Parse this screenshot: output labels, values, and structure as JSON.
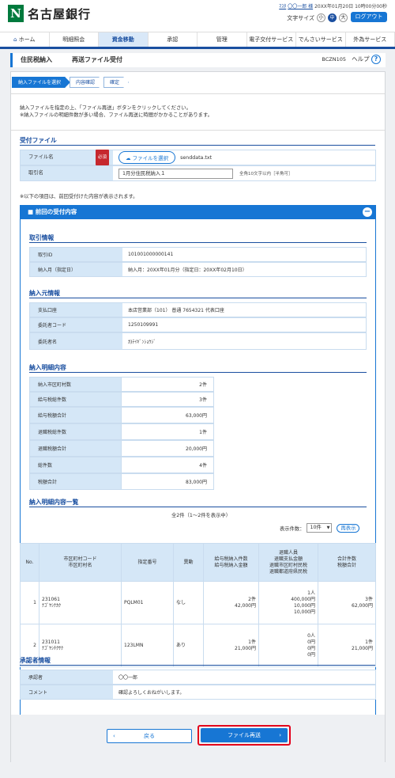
{
  "header": {
    "logo_mark": "N",
    "bank_name": "名古屋銀行",
    "user_prefix": "ﾏｽﾀ",
    "user_name": "〇〇一郎 様",
    "login_time": "20XX年01月20日 10時00分00秒",
    "font_size_label": "文字サイズ",
    "font_small": "小",
    "font_medium": "中",
    "font_large": "大",
    "logout": "ログアウト"
  },
  "nav": {
    "items": [
      "ホーム",
      "明細照会",
      "資金移動",
      "承認",
      "管理",
      "電子交付サービス",
      "でんさいサービス",
      "外為サービス"
    ]
  },
  "page": {
    "title_a": "住民税納入",
    "title_b": "再送ファイル受付",
    "code": "BCZN105",
    "help": "ヘルプ",
    "help_icon": "?"
  },
  "steps": [
    "納入ファイルを選択",
    "内容確認",
    "確定"
  ],
  "instructions": [
    "納入ファイルを指定の上、「ファイル再送」ボタンをクリックしてください。",
    "※納入ファイルの明細件数が多い場合、ファイル再送に時間がかかることがあります。"
  ],
  "upload": {
    "section": "受付ファイル",
    "file_label": "ファイル名",
    "required": "必須",
    "file_button": "ファイルを選択",
    "file_value": "senddata.txt",
    "name_label": "取引名",
    "name_value": "1月分住民税納入１",
    "name_hint": "全角10文字以内［半角可］"
  },
  "note": "※以下の項目は、前回受付けた内容が表示されます。",
  "prev": {
    "title": "前回の受付内容",
    "toggle": "−"
  },
  "torihiki": {
    "section": "取引情報",
    "id_label": "取引ID",
    "id_value": "101001000000141",
    "month_label": "納入月（指定日）",
    "month_value": "納入月：20XX年01月分（指定日：20XX年02月10日）"
  },
  "nounyu": {
    "section": "納入元情報",
    "acct_label": "支払口座",
    "acct_value": "本店営業部（101） 普通 7654321 代表口座",
    "code_label": "委託者コード",
    "code_value": "1250109991",
    "name_label": "委託者名",
    "name_value": "ｶ)ﾃｲｷﾞﾝｼｮｳｼﾞ"
  },
  "summary": {
    "section": "納入明細内容",
    "rows": [
      {
        "label": "納入市区町村数",
        "value": "2件"
      },
      {
        "label": "給与税総件数",
        "value": "3件"
      },
      {
        "label": "給与税額合計",
        "value": "63,000円"
      },
      {
        "label": "退職税総件数",
        "value": "1件"
      },
      {
        "label": "退職税額合計",
        "value": "20,000円"
      },
      {
        "label": "総件数",
        "value": "4件"
      },
      {
        "label": "税額合計",
        "value": "83,000円"
      }
    ]
  },
  "list": {
    "section": "納入明細内容一覧",
    "count_text": "全2件（1～2件を表示中）",
    "per_page_label": "表示件数：",
    "per_page_value": "10件",
    "redisplay": "再表示",
    "headers": [
      [
        "No."
      ],
      [
        "市区町村コード",
        "市区町村名"
      ],
      [
        "指定番号"
      ],
      [
        "異動"
      ],
      [
        "給与税納入件数",
        "給与税納入金額"
      ],
      [
        "退職人員",
        "退職支払金額",
        "退職市区町村民税",
        "退職都道府県民税"
      ],
      [
        "合計件数",
        "税額合計"
      ]
    ],
    "rows": [
      {
        "no": "1",
        "code": "231061",
        "name": "ﾅｺﾞﾔｼﾅｶｸ",
        "shitei": "PQLM01",
        "ido": "なし",
        "kyuyo": [
          "2件",
          "42,000円"
        ],
        "taishoku": [
          "1人",
          "400,000円",
          "10,000円",
          "10,000円"
        ],
        "total": [
          "3件",
          "62,000円"
        ]
      },
      {
        "no": "2",
        "code": "231011",
        "name": "ﾅｺﾞﾔｼﾁｸｻｸ",
        "shitei": "123LMN",
        "ido": "あり",
        "kyuyo": [
          "1件",
          "21,000円"
        ],
        "taishoku": [
          "0人",
          "0円",
          "0円",
          "0円"
        ],
        "total": [
          "1件",
          "21,000円"
        ]
      }
    ]
  },
  "approver": {
    "section": "承認者情報",
    "approver_label": "承認者",
    "approver_value": "〇〇一郎",
    "comment_label": "コメント",
    "comment_value": "確認よろしくおねがいします。"
  },
  "buttons": {
    "back": "戻る",
    "back_arrow": "‹",
    "submit": "ファイル再送",
    "submit_arrow": "›"
  },
  "colors": {
    "primary": "#1776d4",
    "brand_green": "#007a3d",
    "required_red": "#c6282e",
    "highlight_red": "#e3001b"
  }
}
